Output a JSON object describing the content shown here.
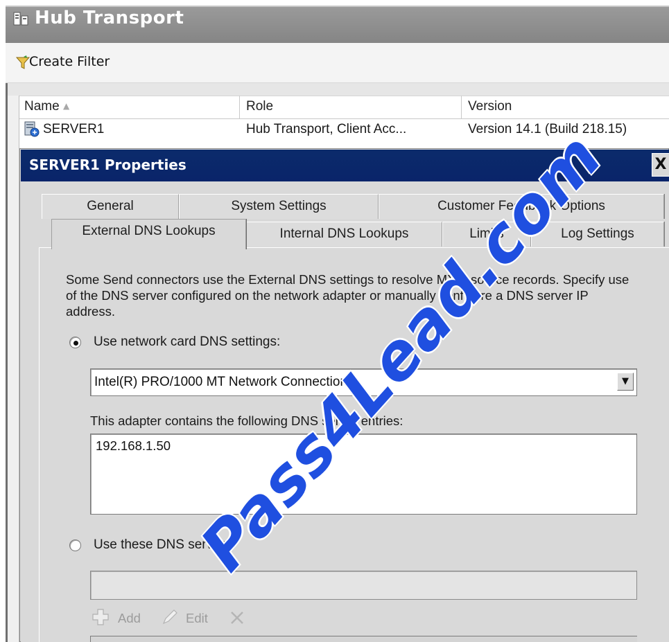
{
  "console": {
    "title": "Hub Transport",
    "toolbar": {
      "create_filter_label": "Create Filter"
    },
    "list": {
      "columns": [
        "Name",
        "Role",
        "Version"
      ],
      "rows": [
        {
          "name": "SERVER1",
          "role": "Hub Transport, Client Acc...",
          "version": "Version 14.1 (Build 218.15)"
        }
      ]
    }
  },
  "dialog": {
    "title": "SERVER1 Properties",
    "close_label": "X",
    "tabs_back": [
      "General",
      "System Settings",
      "Customer Feedback Options"
    ],
    "tabs_front": [
      "External DNS Lookups",
      "Internal DNS Lookups",
      "Limits",
      "Log Settings"
    ],
    "selected_tab": "External DNS Lookups",
    "description": "Some Send connectors use the External DNS settings to resolve MX resource records. Specify use of the DNS server configured on the network adapter or manually configure a DNS server IP address.",
    "option_nic_label": "Use network card DNS settings:",
    "option_nic_checked": true,
    "adapter_selected": "Intel(R) PRO/1000 MT Network Connection",
    "entries_label": "This adapter contains the following DNS server entries:",
    "dns_entries": [
      "192.168.1.50"
    ],
    "option_custom_label": "Use these DNS servers:",
    "option_custom_checked": false,
    "custom_dns_value": "",
    "add_label": "Add",
    "edit_label": "Edit"
  },
  "watermark": "Pass4Lead.com",
  "colors": {
    "title_bar": "#8e8e8e",
    "dialog_title_bar": "#0a246a",
    "dialog_bg": "#d9d9d9",
    "watermark": "#1f4fe0"
  }
}
